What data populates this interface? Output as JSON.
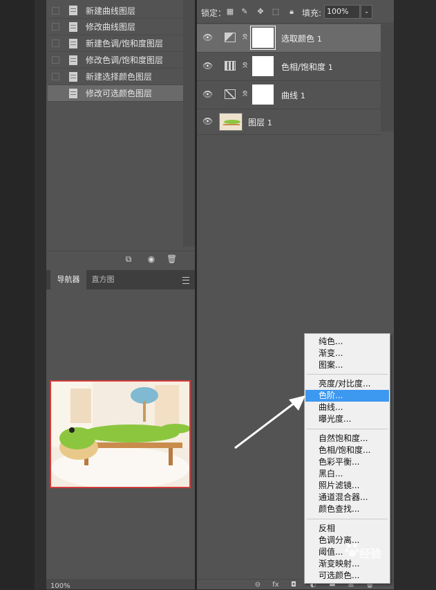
{
  "history": {
    "items": [
      {
        "label": "新建曲线图层",
        "selected": false
      },
      {
        "label": "修改曲线图层",
        "selected": false
      },
      {
        "label": "新建色调/饱和度图层",
        "selected": false
      },
      {
        "label": "修改色调/饱和度图层",
        "selected": false
      },
      {
        "label": "新建选择颜色图层",
        "selected": false
      },
      {
        "label": "修改可选颜色图层",
        "selected": true
      }
    ],
    "footer_icons": [
      "new-document-from-state-icon",
      "camera-icon",
      "trash-icon"
    ]
  },
  "navigator": {
    "tabs": [
      {
        "label": "导航器",
        "active": true
      },
      {
        "label": "直方图",
        "active": false
      }
    ],
    "zoom": "100%"
  },
  "layers": {
    "lock_label": "锁定：",
    "fill_label": "填充:",
    "fill_value": "100%",
    "items": [
      {
        "name": "选取颜色",
        "index": "1",
        "type": "selective-color",
        "selected": true
      },
      {
        "name": "色相/饱和度",
        "index": "1",
        "type": "hue-saturation",
        "selected": false
      },
      {
        "name": "曲线",
        "index": "1",
        "type": "curves",
        "selected": false
      },
      {
        "name": "图层",
        "index": "1",
        "type": "image",
        "selected": false
      }
    ],
    "bottom_icons": [
      "link-icon",
      "fx-icon",
      "mask-icon",
      "adjustment-icon",
      "folder-icon",
      "new-layer-icon",
      "trash-icon"
    ],
    "fx_label": "fx"
  },
  "adjustment_menu": {
    "groups": [
      [
        "纯色...",
        "渐变...",
        "图案..."
      ],
      [
        "亮度/对比度...",
        "色阶...",
        "曲线...",
        "曝光度..."
      ],
      [
        "自然饱和度...",
        "色相/饱和度...",
        "色彩平衡...",
        "黑白...",
        "照片滤镜...",
        "通道混合器...",
        "颜色查找..."
      ],
      [
        "反相",
        "色调分离...",
        "阈值...",
        "渐变映射...",
        "可选颜色..."
      ]
    ],
    "highlighted": "色阶...",
    "highlight_color": "#3d98f0"
  },
  "watermark": "经验",
  "colors": {
    "panel": "#535353",
    "selected_row": "#6b6b6b",
    "navigator_frame": "#d43c3c"
  }
}
